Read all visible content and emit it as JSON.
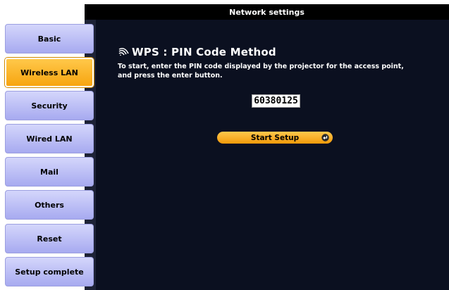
{
  "window": {
    "title": "Network settings"
  },
  "sidebar": {
    "items": [
      {
        "label": "Basic"
      },
      {
        "label": "Wireless LAN"
      },
      {
        "label": "Security"
      },
      {
        "label": "Wired LAN"
      },
      {
        "label": "Mail"
      },
      {
        "label": "Others"
      },
      {
        "label": "Reset"
      },
      {
        "label": "Setup complete"
      }
    ],
    "active_index": 1
  },
  "main": {
    "heading": "WPS : PIN Code Method",
    "heading_icon": "wireless-signal-icon",
    "description_line1": "To start, enter the PIN code displayed by the projector for the access point,",
    "description_line2": "and press the enter button.",
    "pin_code": "60380125",
    "start_button_label": "Start Setup",
    "start_button_icon": "enter-icon"
  },
  "colors": {
    "sidebar_button": "#b9bcf6",
    "sidebar_active": "#f9b227",
    "panel_background": "#0b1020",
    "title_background": "#000000",
    "start_button": "#f8aa1e"
  }
}
